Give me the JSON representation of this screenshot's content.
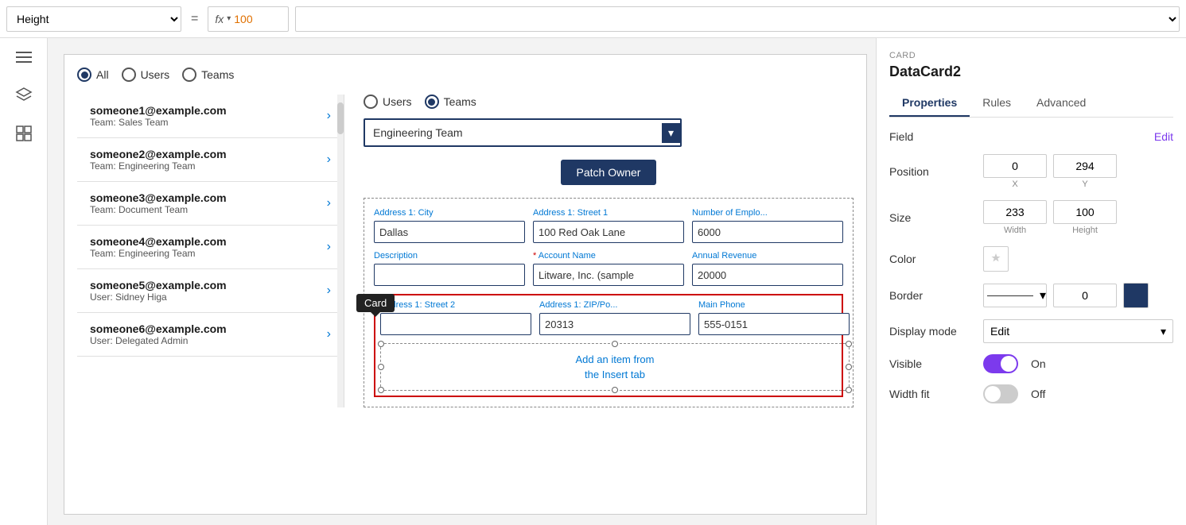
{
  "topbar": {
    "height_label": "Height",
    "equals": "=",
    "fx_label": "fx",
    "formula_value": "100"
  },
  "sidebar_icons": [
    "menu",
    "layers",
    "grid"
  ],
  "canvas": {
    "radio_group": {
      "options": [
        "All",
        "Users",
        "Teams"
      ],
      "selected": "All"
    },
    "user_list": [
      {
        "email": "someone1@example.com",
        "team": "Team: Sales Team"
      },
      {
        "email": "someone2@example.com",
        "team": "Team: Engineering Team"
      },
      {
        "email": "someone3@example.com",
        "team": "Team: Document Team"
      },
      {
        "email": "someone4@example.com",
        "team": "Team: Engineering Team"
      },
      {
        "email": "someone5@example.com",
        "team": "User: Sidney Higa"
      },
      {
        "email": "someone6@example.com",
        "team": "User: Delegated Admin"
      }
    ],
    "detail": {
      "teams_radio": {
        "options": [
          "Users",
          "Teams"
        ],
        "selected": "Teams"
      },
      "dropdown_value": "Engineering Team",
      "patch_owner_label": "Patch Owner",
      "form_fields": [
        {
          "label": "Address 1: City",
          "value": "Dallas",
          "required": false
        },
        {
          "label": "Address 1: Street 1",
          "value": "100 Red Oak Lane",
          "required": false
        },
        {
          "label": "Number of Emplo...",
          "value": "6000",
          "required": false
        },
        {
          "label": "Description",
          "value": "",
          "required": false
        },
        {
          "label": "Account Name",
          "value": "Litware, Inc. (sample",
          "required": true
        },
        {
          "label": "Annual Revenue",
          "value": "20000",
          "required": false
        },
        {
          "label": "Address 1: Street 2",
          "value": "",
          "required": false
        },
        {
          "label": "Address 1: ZIP/Po...",
          "value": "20313",
          "required": false
        },
        {
          "label": "Main Phone",
          "value": "555-0151",
          "required": false
        }
      ],
      "card_tooltip": "Card",
      "add_item_text": "Add an item from\nthe Insert tab"
    }
  },
  "properties": {
    "card_label": "CARD",
    "component_name": "DataCard2",
    "tabs": [
      "Properties",
      "Rules",
      "Advanced"
    ],
    "active_tab": "Properties",
    "field_label": "Field",
    "edit_label": "Edit",
    "position_label": "Position",
    "position_x": "0",
    "position_y": "294",
    "x_label": "X",
    "y_label": "Y",
    "size_label": "Size",
    "size_width": "233",
    "size_height": "100",
    "width_label": "Width",
    "height_label": "Height",
    "color_label": "Color",
    "border_label": "Border",
    "border_width": "0",
    "display_mode_label": "Display mode",
    "display_mode_value": "Edit",
    "visible_label": "Visible",
    "visible_state": "On",
    "width_fit_label": "Width fit",
    "width_fit_state": "Off"
  }
}
